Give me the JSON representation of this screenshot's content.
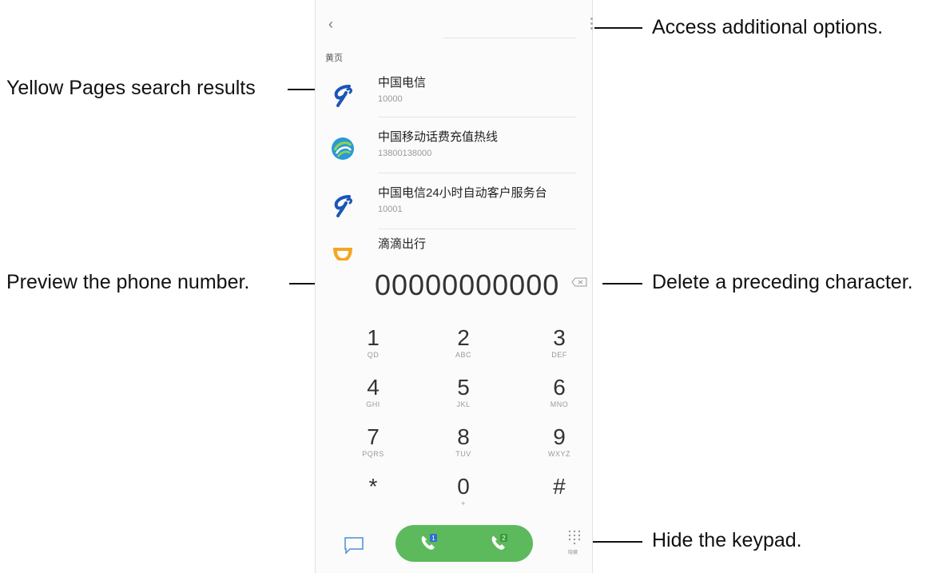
{
  "annotations": {
    "more_options": "Access additional options.",
    "yellow_pages": "Yellow Pages search results",
    "preview_number": "Preview the phone number.",
    "delete_char": "Delete a preceding character.",
    "hide_keypad": "Hide the keypad."
  },
  "header": {
    "back_icon": "back-arrow-icon",
    "more_icon": "more-options-icon"
  },
  "section_label": "黄页",
  "results": [
    {
      "name": "中国电信",
      "number": "10000",
      "icon": "china-telecom-icon"
    },
    {
      "name": "中国移动话费充值热线",
      "number": "13800138000",
      "icon": "china-mobile-icon"
    },
    {
      "name": "中国电信24小时自动客户服务台",
      "number": "10001",
      "icon": "china-telecom-icon"
    },
    {
      "name": "滴滴出行",
      "number": "",
      "icon": "didi-icon"
    }
  ],
  "dialed_number": "00000000000",
  "keys": [
    {
      "digit": "1",
      "letters": "QD"
    },
    {
      "digit": "2",
      "letters": "ABC"
    },
    {
      "digit": "3",
      "letters": "DEF"
    },
    {
      "digit": "4",
      "letters": "GHI"
    },
    {
      "digit": "5",
      "letters": "JKL"
    },
    {
      "digit": "6",
      "letters": "MNO"
    },
    {
      "digit": "7",
      "letters": "PQRS"
    },
    {
      "digit": "8",
      "letters": "TUV"
    },
    {
      "digit": "9",
      "letters": "WXYZ"
    },
    {
      "digit": "*",
      "letters": ""
    },
    {
      "digit": "0",
      "letters": "+"
    },
    {
      "digit": "#",
      "letters": ""
    }
  ],
  "call": {
    "sim1_badge": "1",
    "sim2_badge": "2",
    "color": "#5cba5c"
  },
  "hide_keypad_label": "隐藏"
}
